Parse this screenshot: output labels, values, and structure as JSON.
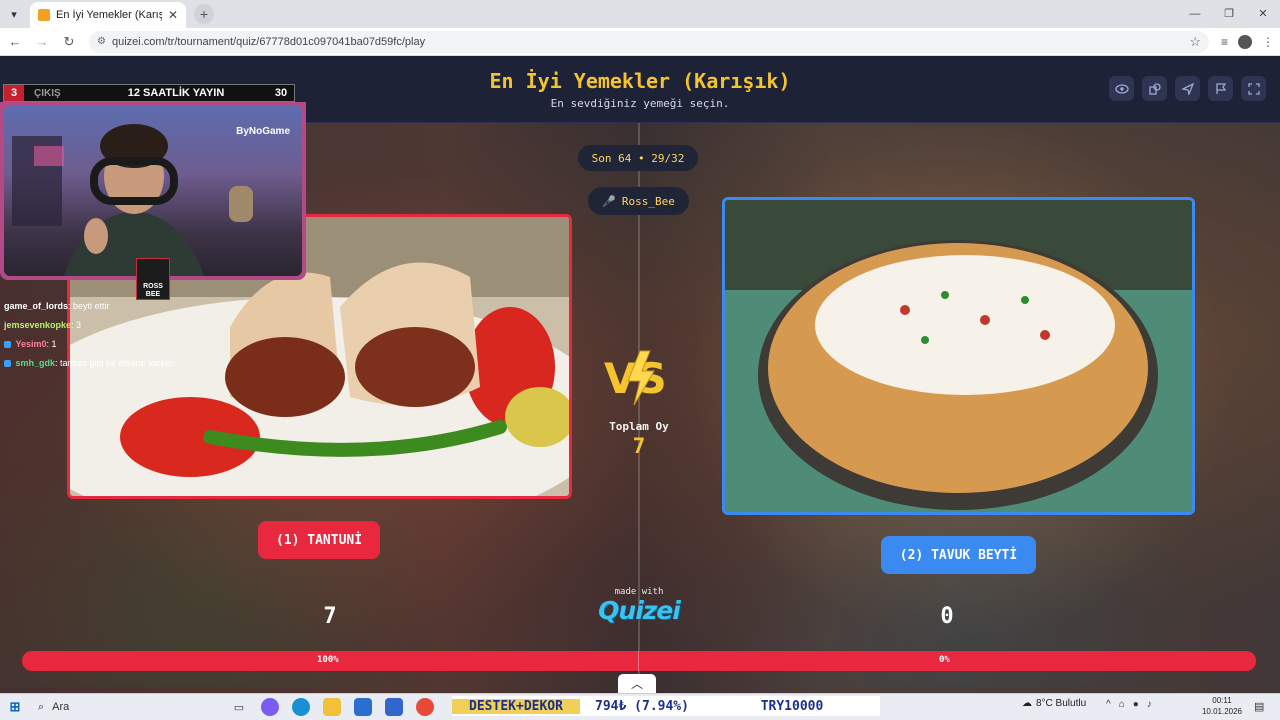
{
  "browser": {
    "tab_title": "En İyi Yemekler (Karışık) - Tier L",
    "tab_close": "✕",
    "new_tab": "+",
    "url": "quizei.com/tr/tournament/quiz/67778d01c097041ba07d59fc/play"
  },
  "header": {
    "title": "En İyi Yemekler (Karışık)",
    "subtitle": "En sevdiğiniz yemeği seçin.",
    "icons": [
      "eye-icon",
      "shapes-icon",
      "send-icon",
      "flag-icon",
      "fullscreen-icon"
    ]
  },
  "round": {
    "label": "Son 64 • 29/32"
  },
  "player": {
    "name": "Ross_Bee"
  },
  "vs_text": "VS",
  "total": {
    "label": "Toplam Oy",
    "value": "7"
  },
  "left": {
    "button": "(1) TANTUNİ",
    "score": "7",
    "percent": "100%",
    "color": "#e8283e"
  },
  "right": {
    "button": "(2) TAVUK BEYTİ",
    "score": "0",
    "percent": "0%",
    "color": "#3a8af2"
  },
  "progress": {
    "left_fraction": 1.0
  },
  "branding": {
    "made_with": "made with",
    "logo": "Quizei"
  },
  "stream": {
    "counter_left": "3",
    "exit_label": "ÇIKIŞ",
    "title": "12 SAATLİK YAYIN",
    "counter_right": "30",
    "cam_brand": "ByNoGame",
    "logo_text": "ROSS BEE",
    "chat": [
      {
        "user": "game_of_lords",
        "msg": ": beyti ettir",
        "color": "#ffffff"
      },
      {
        "user": "jemsevenkopke",
        "msg": ": 3",
        "color": "#b7f06a"
      },
      {
        "user": "Yesim0",
        "msg": ": 1",
        "color": "#ff7fa0"
      },
      {
        "user": "smh_gdk",
        "msg": ": tantuni gibi bir efsane varken",
        "color": "#4ee08a"
      }
    ]
  },
  "taskbar": {
    "search": "Ara",
    "ticker_1": "DESTEK+DEKOR",
    "ticker_2": "794₺ (7.94%)",
    "ticker_3": "TRY10000",
    "weather": "8°C  Bulutlu",
    "time": "00:11",
    "date": "10.01.2026"
  }
}
